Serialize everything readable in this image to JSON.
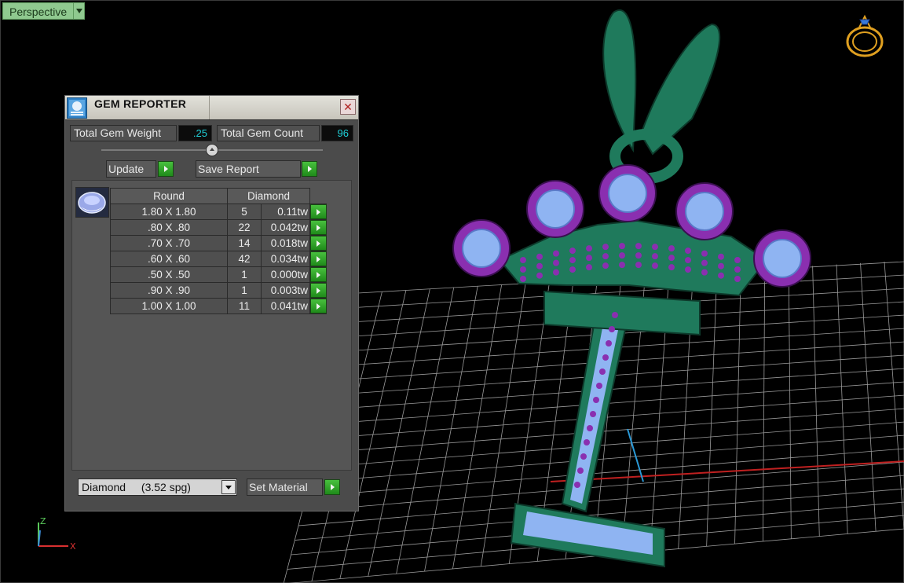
{
  "viewport": {
    "view_name": "Perspective",
    "axis_labels": {
      "z": "Z",
      "x": "X"
    }
  },
  "gem_reporter": {
    "title": "GEM REPORTER",
    "close_glyph": "✕",
    "total_weight_label": "Total Gem Weight",
    "total_weight_value": ".25",
    "total_count_label": "Total Gem Count",
    "total_count_value": "96",
    "update_label": "Update",
    "save_report_label": "Save Report",
    "table_header": {
      "shape": "Round",
      "material": "Diamond"
    },
    "rows": [
      {
        "size": "1.80 X 1.80",
        "count": "5",
        "weight": "0.11tw"
      },
      {
        "size": ".80 X .80",
        "count": "22",
        "weight": "0.042tw"
      },
      {
        "size": ".70 X .70",
        "count": "14",
        "weight": "0.018tw"
      },
      {
        "size": ".60 X .60",
        "count": "42",
        "weight": "0.034tw"
      },
      {
        "size": ".50 X .50",
        "count": "1",
        "weight": "0.000tw"
      },
      {
        "size": ".90 X .90",
        "count": "1",
        "weight": "0.003tw"
      },
      {
        "size": "1.00 X 1.00",
        "count": "11",
        "weight": "0.041tw"
      }
    ],
    "material_name": "Diamond",
    "material_density": "(3.52 spg)",
    "set_material_label": "Set Material"
  },
  "colors": {
    "metal": "#1f7a5c",
    "gem": "#8fb4f2",
    "prong": "#8a2fb0",
    "grid": "#9a9a9a",
    "ring_icon": "#e0a020"
  }
}
